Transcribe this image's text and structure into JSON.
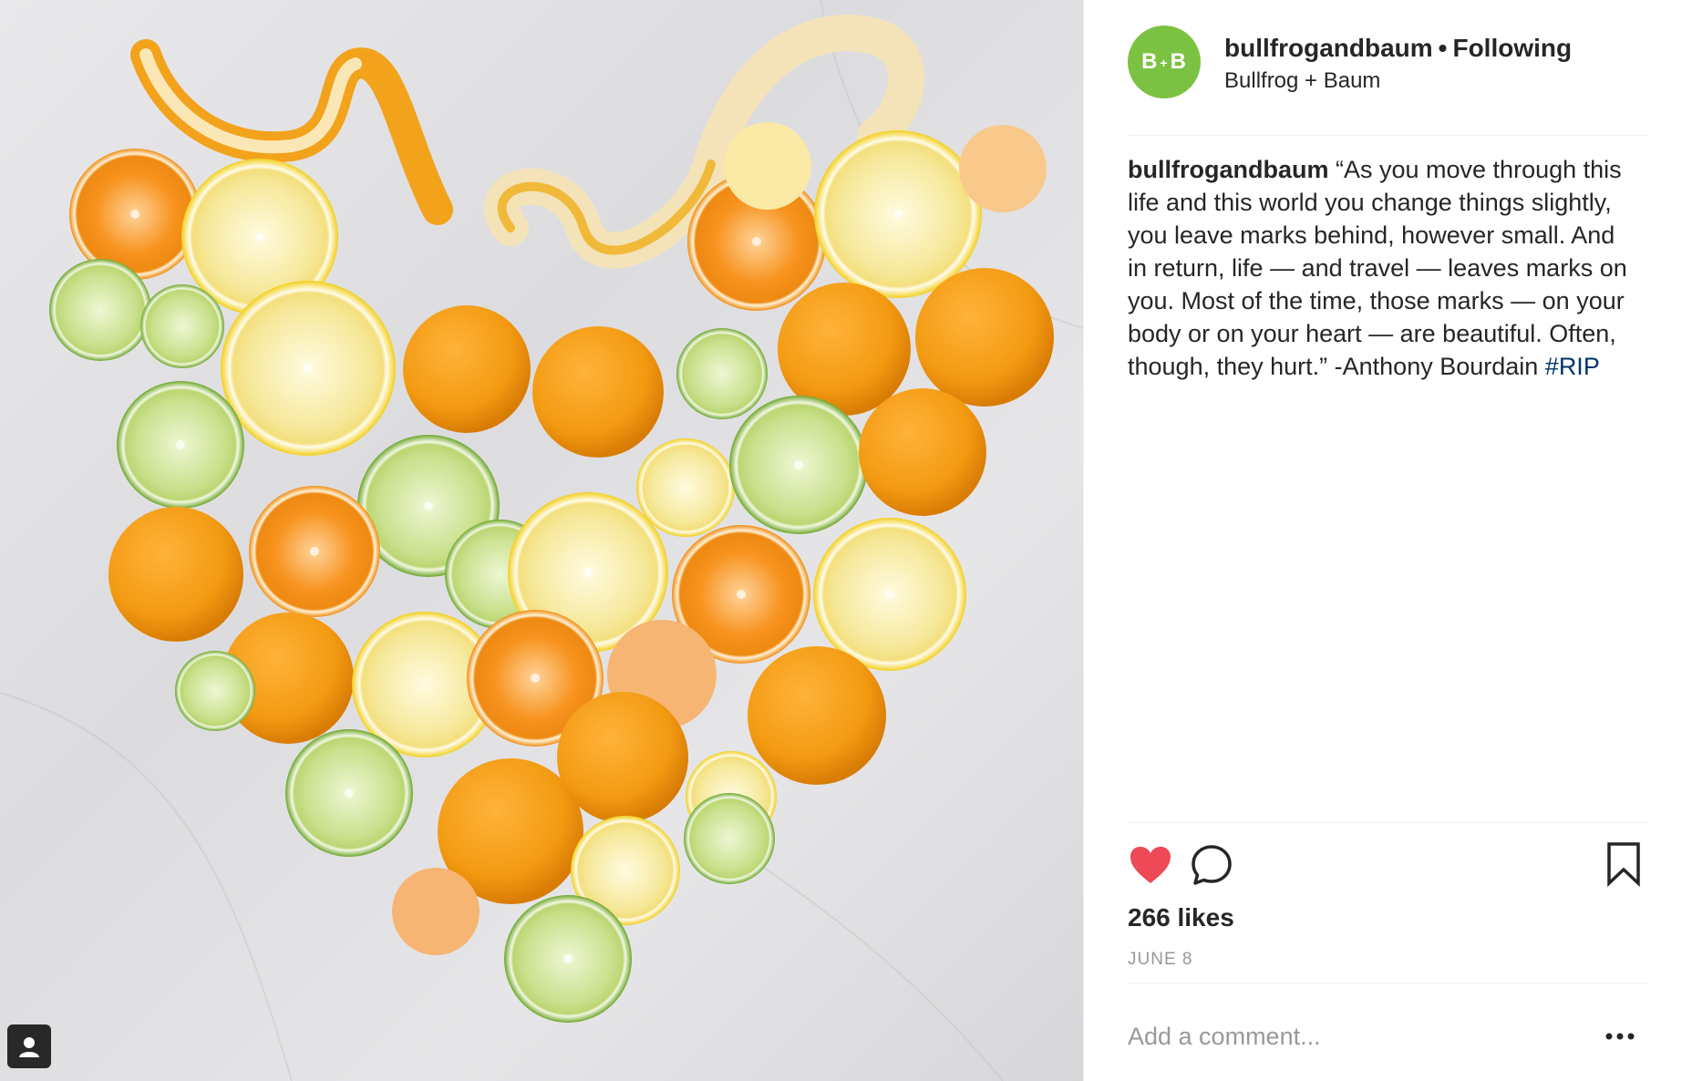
{
  "post": {
    "username": "bullfrogandbaum",
    "separator": "•",
    "follow_status": "Following",
    "display_name": "Bullfrog + Baum",
    "avatar": {
      "letters_left": "B",
      "letters_plus": "+",
      "letters_right": "B",
      "color": "#7cc242"
    },
    "caption_user": "bullfrogandbaum",
    "caption_text": "“As you move through this life and this world you change things slightly, you leave marks behind, however small. And in return, life — and travel — leaves marks on you. Most of the time, those marks — on your body or on your heart — are beautiful. Often, though, they hurt.” -Anthony Bourdain ",
    "hashtag": "#RIP",
    "hashtag_color": "#003569",
    "likes": "266 likes",
    "date": "JUNE 8",
    "comment_placeholder": "Add a comment...",
    "like_color": "#ed4956",
    "icons": {
      "like": "heart-icon",
      "comment": "comment-icon",
      "save": "bookmark-icon",
      "more": "more-options-icon",
      "tag": "user-tag-icon"
    }
  }
}
